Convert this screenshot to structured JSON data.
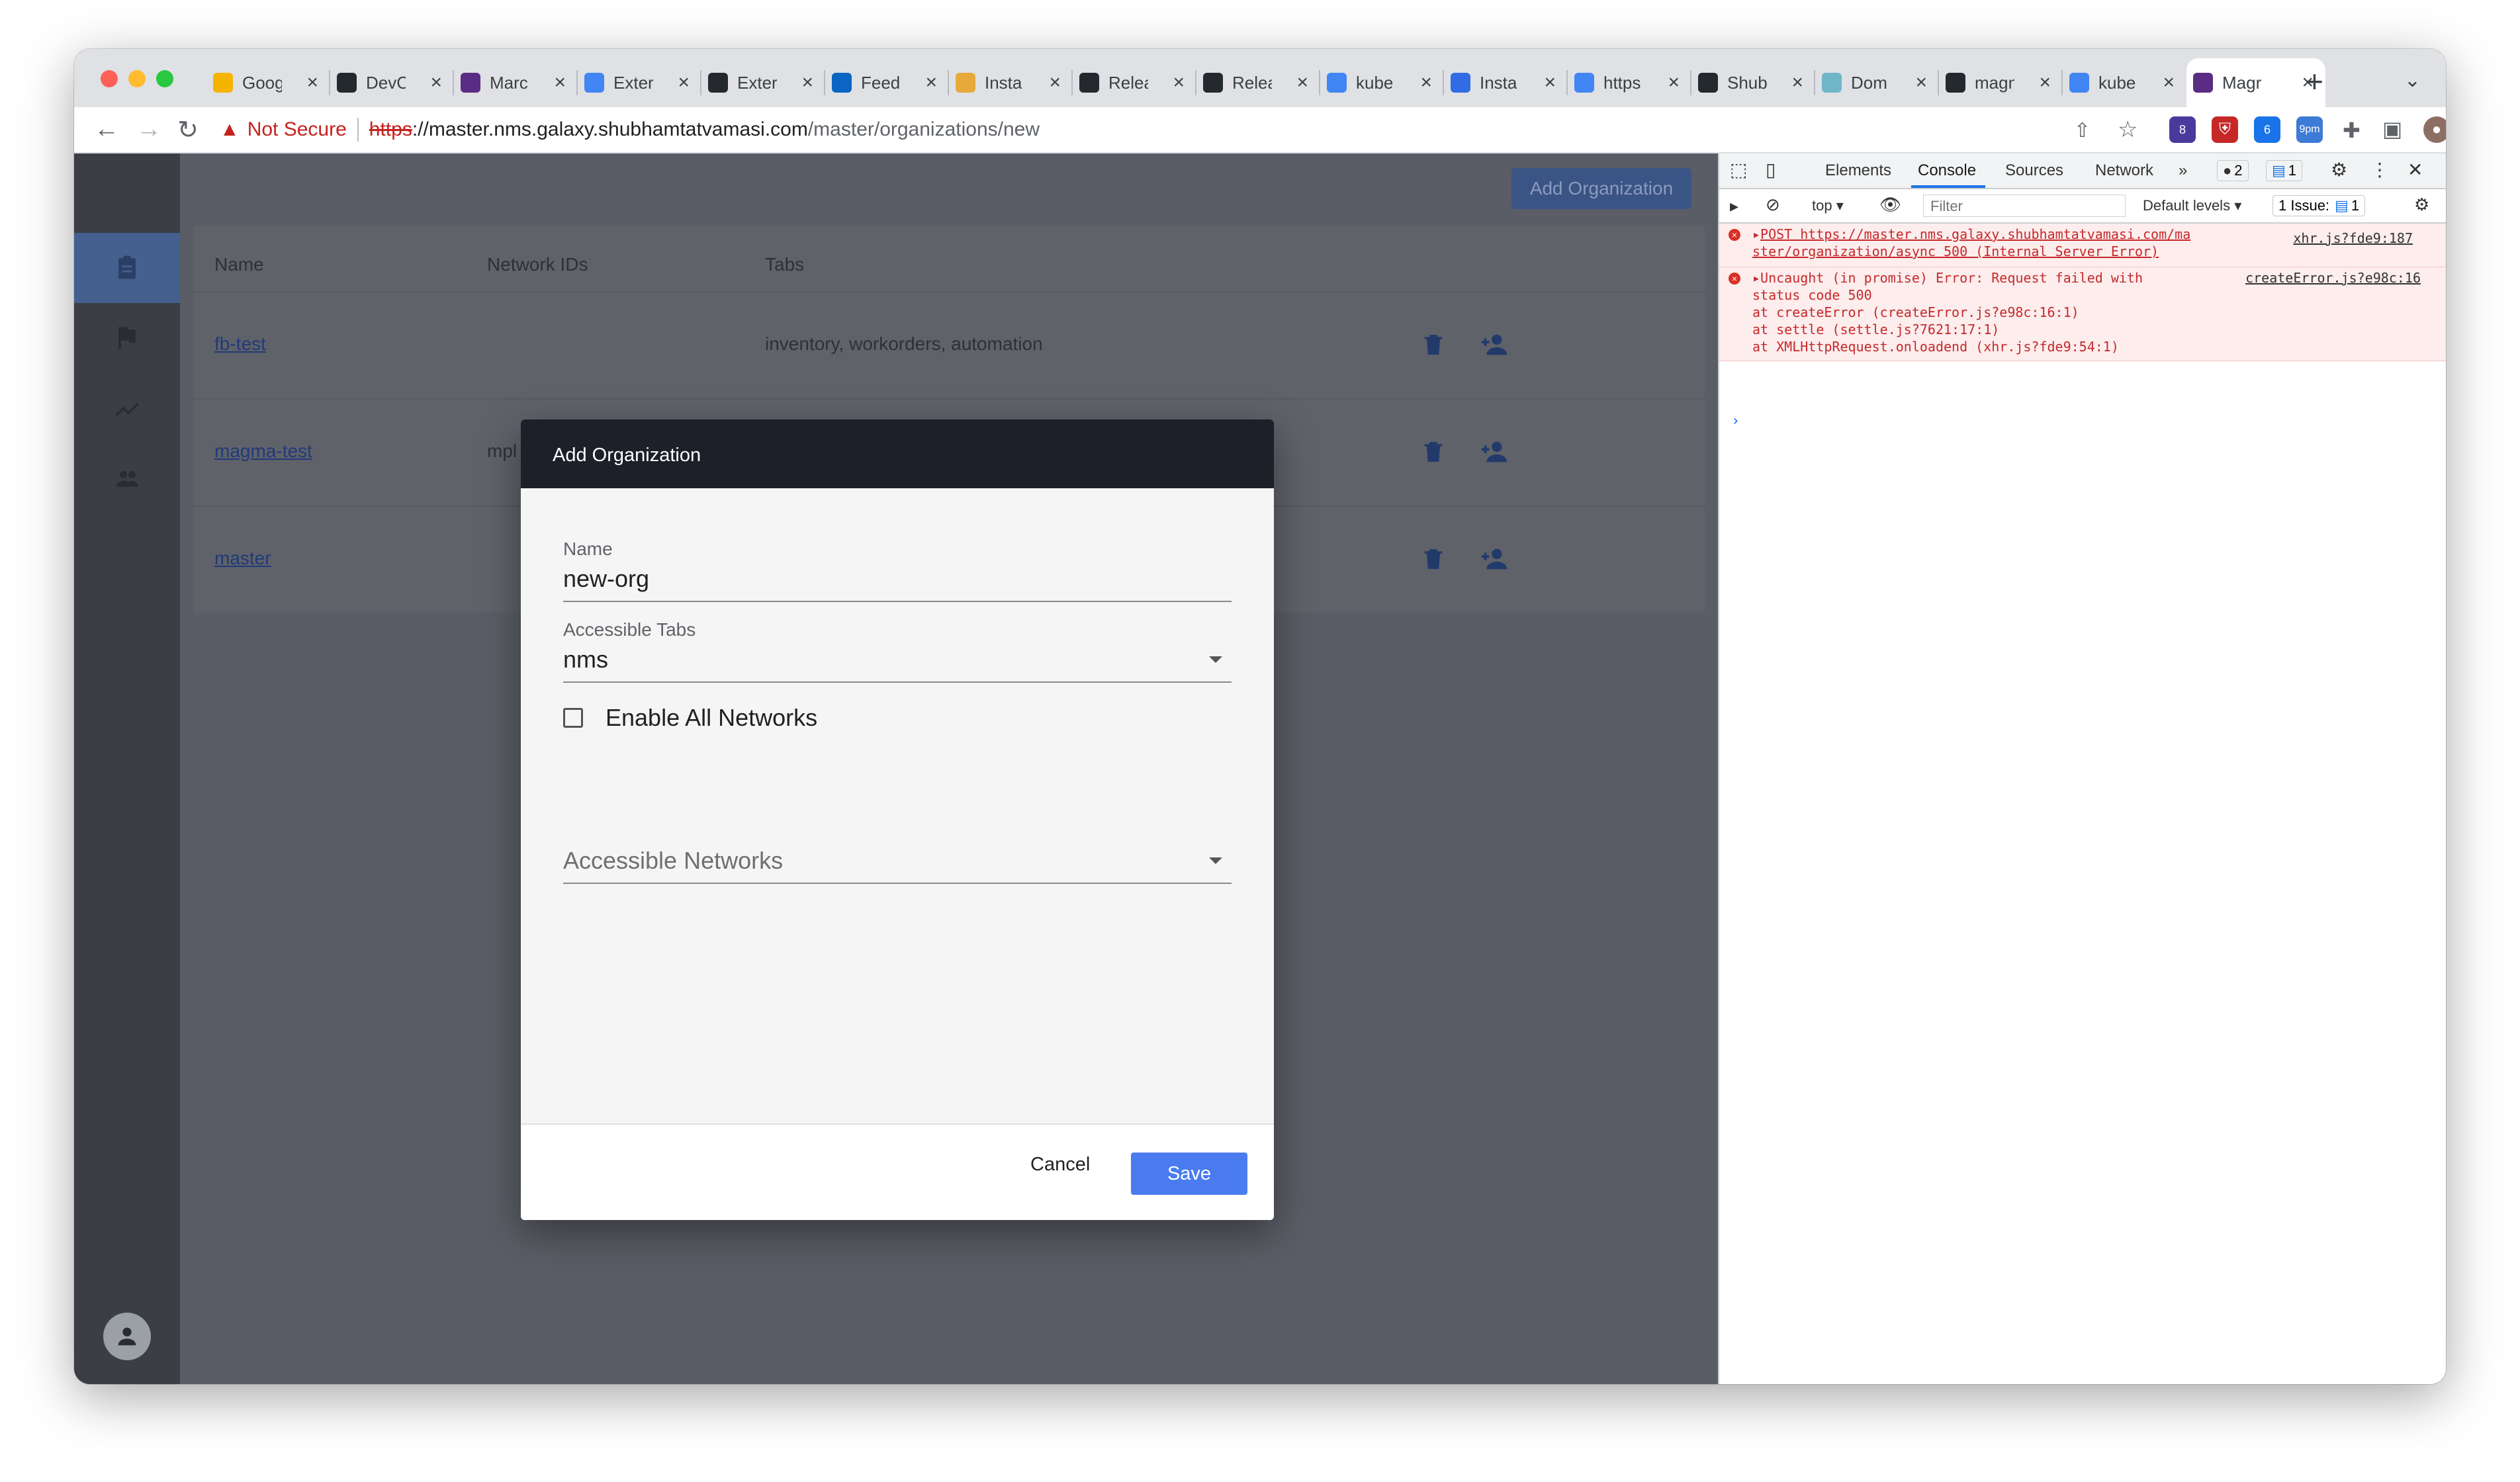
{
  "browser": {
    "tabs": [
      {
        "title": "Goog",
        "icon": "google-keep-icon",
        "color": "#f4b400"
      },
      {
        "title": "DevC",
        "icon": "github-icon",
        "color": "#24292e"
      },
      {
        "title": "Marc",
        "icon": "magma-icon",
        "color": "#5b2c83"
      },
      {
        "title": "Exter",
        "icon": "google-docs-icon",
        "color": "#4285f4"
      },
      {
        "title": "Exter",
        "icon": "github-icon",
        "color": "#24292e"
      },
      {
        "title": "Feed",
        "icon": "linkedin-icon",
        "color": "#0a66c2"
      },
      {
        "title": "Insta",
        "icon": "package-icon",
        "color": "#e8a93b"
      },
      {
        "title": "Relea",
        "icon": "github-icon",
        "color": "#24292e"
      },
      {
        "title": "Relea",
        "icon": "github-icon",
        "color": "#24292e"
      },
      {
        "title": "kube",
        "icon": "google-icon",
        "color": "#4285f4"
      },
      {
        "title": "Insta",
        "icon": "kubernetes-icon",
        "color": "#326ce5"
      },
      {
        "title": "https",
        "icon": "gcp-icon",
        "color": "#4285f4"
      },
      {
        "title": "Shub",
        "icon": "github-icon",
        "color": "#24292e"
      },
      {
        "title": "Dom",
        "icon": "domain-icon",
        "color": "#6fb6c9"
      },
      {
        "title": "magn",
        "icon": "github-icon",
        "color": "#24292e"
      },
      {
        "title": "kube",
        "icon": "google-icon",
        "color": "#4285f4"
      },
      {
        "title": "Magr",
        "icon": "magma-icon",
        "color": "#5b2c83",
        "active": true
      }
    ],
    "address": {
      "warning": "Not Secure",
      "scheme": "https",
      "host": "://master.nms.galaxy.shubhamtatvamasi.com",
      "path": "/master/organizations/new"
    },
    "extensions": {
      "badge1": "8",
      "badge2": "6",
      "badge3": "9pm"
    }
  },
  "app": {
    "add_button": "Add Organization",
    "table": {
      "headers": [
        "Name",
        "Network IDs",
        "Tabs"
      ],
      "rows": [
        {
          "name": "fb-test",
          "network": "",
          "tabs": "inventory, workorders, automation"
        },
        {
          "name": "magma-test",
          "network": "mpl",
          "tabs": ""
        },
        {
          "name": "master",
          "network": "",
          "tabs": ""
        }
      ]
    }
  },
  "dialog": {
    "title": "Add Organization",
    "name_label": "Name",
    "name_value": "new-org",
    "tabs_label": "Accessible Tabs",
    "tabs_value": "nms",
    "enable_all": "Enable All Networks",
    "networks_placeholder": "Accessible Networks",
    "cancel": "Cancel",
    "save": "Save"
  },
  "devtools": {
    "tabs": [
      "Elements",
      "Console",
      "Sources",
      "Network"
    ],
    "active_tab": "Console",
    "error_count": "2",
    "message_count": "1",
    "context": "top",
    "filter_placeholder": "Filter",
    "levels": "Default levels",
    "issues_label": "1 Issue:",
    "issues_count": "1",
    "errors": [
      {
        "line1": "POST https://master.nms.galaxy.shubhamtatvamasi.com/ma",
        "line2": "ster/organization/async 500 (Internal Server Error)",
        "source": "xhr.js?fde9:187"
      },
      {
        "line1": "Uncaught (in promise) Error: Request failed with",
        "line2": "status code 500",
        "line3": "    at createError (createError.js?e98c:16:1)",
        "line4": "    at settle (settle.js?7621:17:1)",
        "line5": "    at XMLHttpRequest.onloadend (xhr.js?fde9:54:1)",
        "source": "createError.js?e98c:16"
      }
    ]
  }
}
